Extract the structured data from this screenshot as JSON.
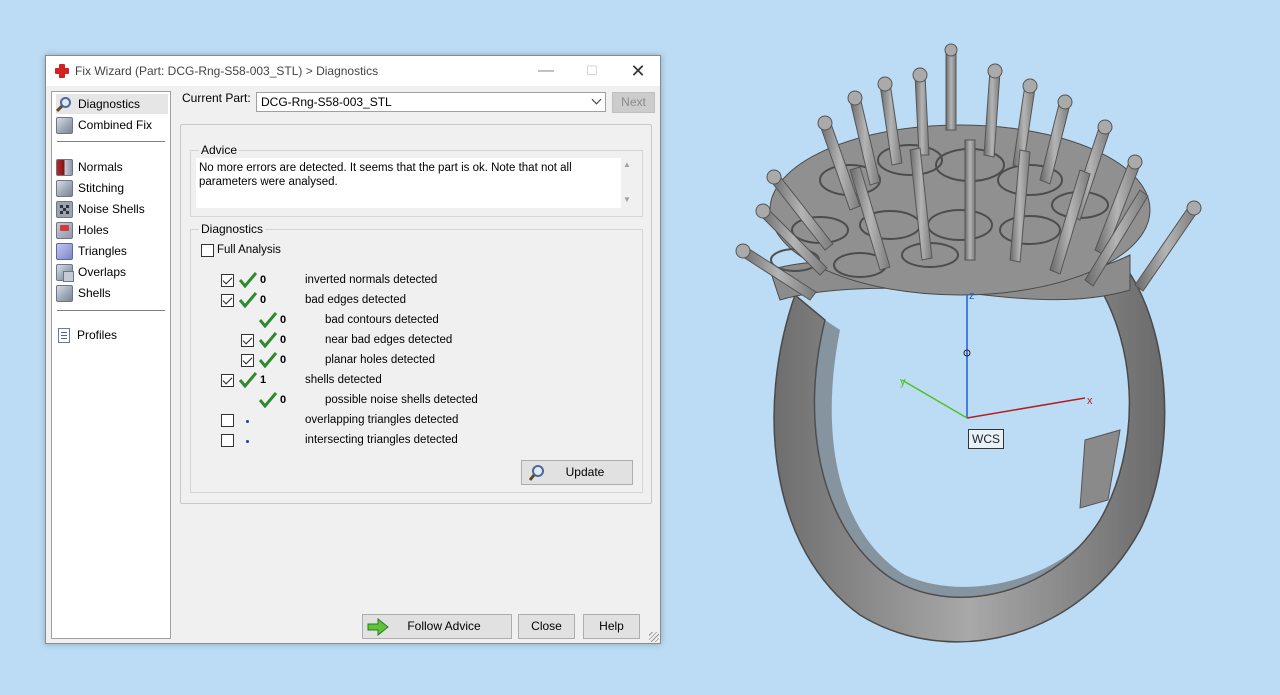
{
  "window": {
    "title": "Fix Wizard (Part: DCG-Rng-S58-003_STL) > Diagnostics",
    "minimize": "—",
    "maximize": "☐",
    "close": "✕"
  },
  "nav": {
    "items": [
      {
        "label": "Diagnostics",
        "icon": "magnifier-icon"
      },
      {
        "label": "Combined Fix",
        "icon": "cube-icon"
      },
      {
        "label": "Normals",
        "icon": "normals-icon"
      },
      {
        "label": "Stitching",
        "icon": "stitching-icon"
      },
      {
        "label": "Noise Shells",
        "icon": "noise-shells-icon"
      },
      {
        "label": "Holes",
        "icon": "holes-icon"
      },
      {
        "label": "Triangles",
        "icon": "triangles-icon"
      },
      {
        "label": "Overlaps",
        "icon": "overlaps-icon"
      },
      {
        "label": "Shells",
        "icon": "shells-icon"
      },
      {
        "label": "Profiles",
        "icon": "profiles-icon"
      }
    ]
  },
  "current_part": {
    "label": "Current Part:",
    "value": "DCG-Rng-S58-003_STL",
    "next_label": "Next"
  },
  "advice": {
    "title": "Advice",
    "text_line1": "No more errors are detected. It seems that the part is ok. Note that not all",
    "text_line2": "parameters were analysed."
  },
  "diagnostics": {
    "title": "Diagnostics",
    "full_analysis_label": "Full Analysis",
    "full_analysis_checked": false,
    "rows": [
      {
        "checked": true,
        "status": "ok",
        "count": "0",
        "label": "inverted normals detected"
      },
      {
        "checked": true,
        "status": "ok",
        "count": "0",
        "label": "bad edges detected"
      },
      {
        "checked": null,
        "status": "ok",
        "count": "0",
        "label": "bad contours detected"
      },
      {
        "checked": true,
        "status": "ok",
        "count": "0",
        "label": "near bad edges detected"
      },
      {
        "checked": true,
        "status": "ok",
        "count": "0",
        "label": "planar holes detected"
      },
      {
        "checked": true,
        "status": "ok",
        "count": "1",
        "label": "shells detected"
      },
      {
        "checked": null,
        "status": "ok",
        "count": "0",
        "label": "possible noise shells detected"
      },
      {
        "checked": false,
        "status": "pending",
        "count": "",
        "label": "overlapping triangles detected"
      },
      {
        "checked": false,
        "status": "pending",
        "count": "",
        "label": "intersecting triangles detected"
      }
    ],
    "update_label": "Update"
  },
  "buttons": {
    "follow_advice": "Follow Advice",
    "close": "Close",
    "help": "Help"
  },
  "viewport": {
    "wcs_label": "WCS",
    "axis_x": "x",
    "axis_y": "y",
    "axis_z": "z",
    "colors": {
      "x_axis": "#b32020",
      "y_axis": "#4fc41f",
      "z_axis": "#1d5fd6",
      "model": "#8c8c8c"
    }
  }
}
